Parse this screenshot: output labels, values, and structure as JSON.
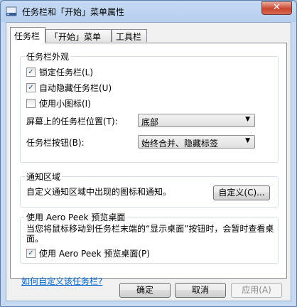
{
  "window": {
    "title": "任务栏和「开始」菜单属性",
    "close_label": "✕"
  },
  "tabs": [
    {
      "label": "任务栏"
    },
    {
      "label": "「开始」菜单"
    },
    {
      "label": "工具栏"
    }
  ],
  "appearance": {
    "title": "任务栏外观",
    "lock": {
      "label": "锁定任务栏(L)",
      "checked": true
    },
    "autohide": {
      "label": "自动隐藏任务栏(U)",
      "checked": true
    },
    "small_icons": {
      "label": "使用小图标(I)",
      "checked": false
    },
    "position_label": "屏幕上的任务栏位置(T):",
    "position_value": "底部",
    "buttons_label": "任务栏按钮(B):",
    "buttons_value": "始终合并、隐藏标签"
  },
  "notification": {
    "title": "通知区域",
    "description": "自定义通知区域中出现的图标和通知。",
    "customize_button": "自定义(C)..."
  },
  "aero_peek": {
    "title": "使用 Aero Peek 预览桌面",
    "description": "当您将鼠标移动到任务栏末端的“显示桌面”按钮时，会暂时查看桌面。",
    "checkbox": {
      "label": "使用 Aero Peek 预览桌面(P)",
      "checked": true
    }
  },
  "help_link": "如何自定义该任务栏?",
  "footer": {
    "ok": "确定",
    "cancel": "取消",
    "apply": "应用(A)"
  }
}
